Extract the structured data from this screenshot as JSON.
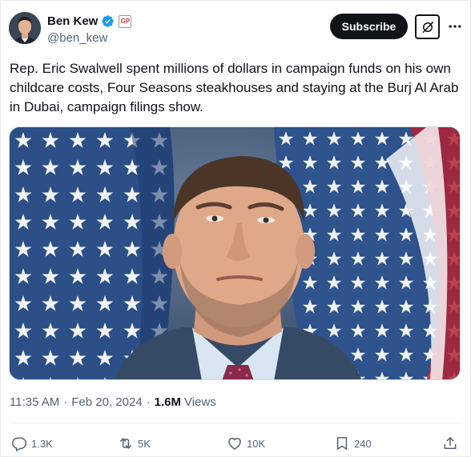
{
  "author": {
    "name": "Ben Kew",
    "handle": "@ben_kew",
    "affiliate_badge": "GP"
  },
  "header": {
    "subscribe_label": "Subscribe"
  },
  "tweet": {
    "text": "Rep. Eric Swalwell spent millions of dollars in campaign funds on his own childcare costs, Four Seasons steakhouses and staying at the Burj Al Arab in Dubai, campaign filings show.",
    "time": "11:35 AM",
    "separator": "·",
    "date": "Feb 20, 2024",
    "views_count": "1.6M",
    "views_label": "Views"
  },
  "actions": {
    "replies": "1.3K",
    "reposts": "5K",
    "likes": "10K",
    "bookmarks": "240"
  },
  "colors": {
    "text_primary": "#0f1419",
    "text_secondary": "#536471",
    "verified_blue": "#1d9bf0",
    "flag_blue": "#2b4f86",
    "flag_red": "#b22234"
  }
}
